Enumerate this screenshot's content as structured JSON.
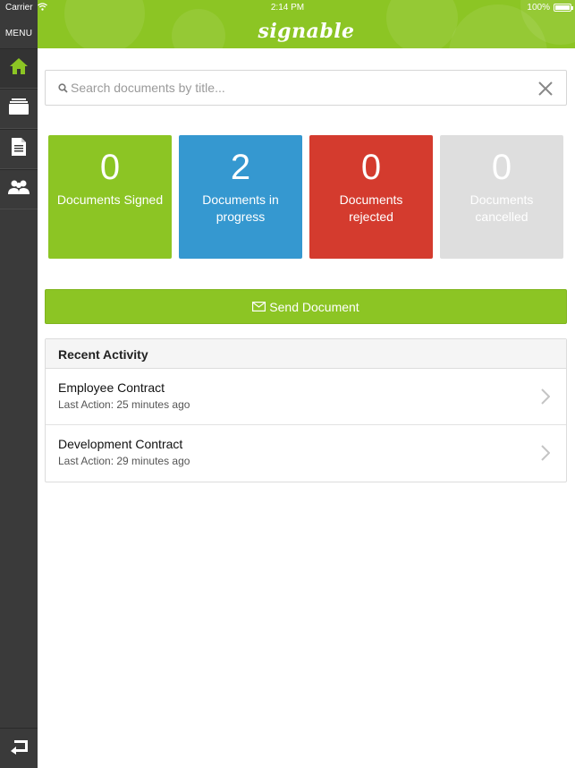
{
  "status_bar": {
    "carrier": "Carrier",
    "time": "2:14 PM",
    "battery": "100%"
  },
  "sidebar": {
    "menu_label": "MENU",
    "items": [
      {
        "icon": "home-icon",
        "active": true
      },
      {
        "icon": "archive-icon",
        "active": false
      },
      {
        "icon": "document-icon",
        "active": false
      },
      {
        "icon": "contacts-icon",
        "active": false
      }
    ],
    "bottom_icon": "logout-icon"
  },
  "header": {
    "logo": "signable"
  },
  "search": {
    "placeholder": "Search documents by title..."
  },
  "stats": [
    {
      "count": "0",
      "label": "Documents Signed",
      "color": "#8cc524"
    },
    {
      "count": "2",
      "label": "Documents in progress",
      "color": "#3598d0"
    },
    {
      "count": "0",
      "label": "Documents rejected",
      "color": "#d43b2e"
    },
    {
      "count": "0",
      "label": "Documents cancelled",
      "color": "#dedede"
    }
  ],
  "send_button": {
    "label": "Send Document"
  },
  "recent_activity": {
    "heading": "Recent Activity",
    "items": [
      {
        "title": "Employee Contract",
        "subtitle": "Last Action: 25 minutes ago"
      },
      {
        "title": "Development Contract",
        "subtitle": "Last Action: 29 minutes ago"
      }
    ]
  },
  "colors": {
    "brand_green": "#8cc524",
    "sidebar_dark": "#3a3a3a"
  }
}
